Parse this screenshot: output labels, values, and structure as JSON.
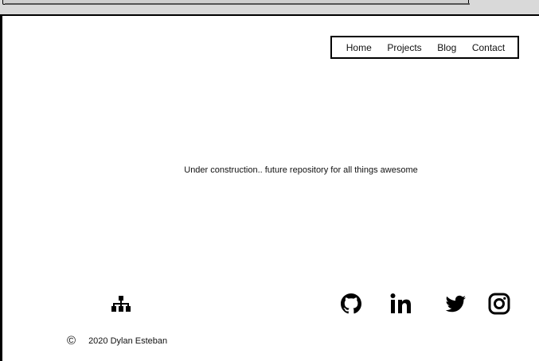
{
  "nav": {
    "items": [
      "Home",
      "Projects",
      "Blog",
      "Contact"
    ]
  },
  "main": {
    "message": "Under construction.. future repository for all things awesome"
  },
  "footer": {
    "copyright_symbol": "©",
    "copyright_text": "2020 Dylan Esteban",
    "icons": [
      "sitemap-icon",
      "github-icon",
      "linkedin-icon",
      "twitter-icon",
      "instagram-icon"
    ]
  }
}
